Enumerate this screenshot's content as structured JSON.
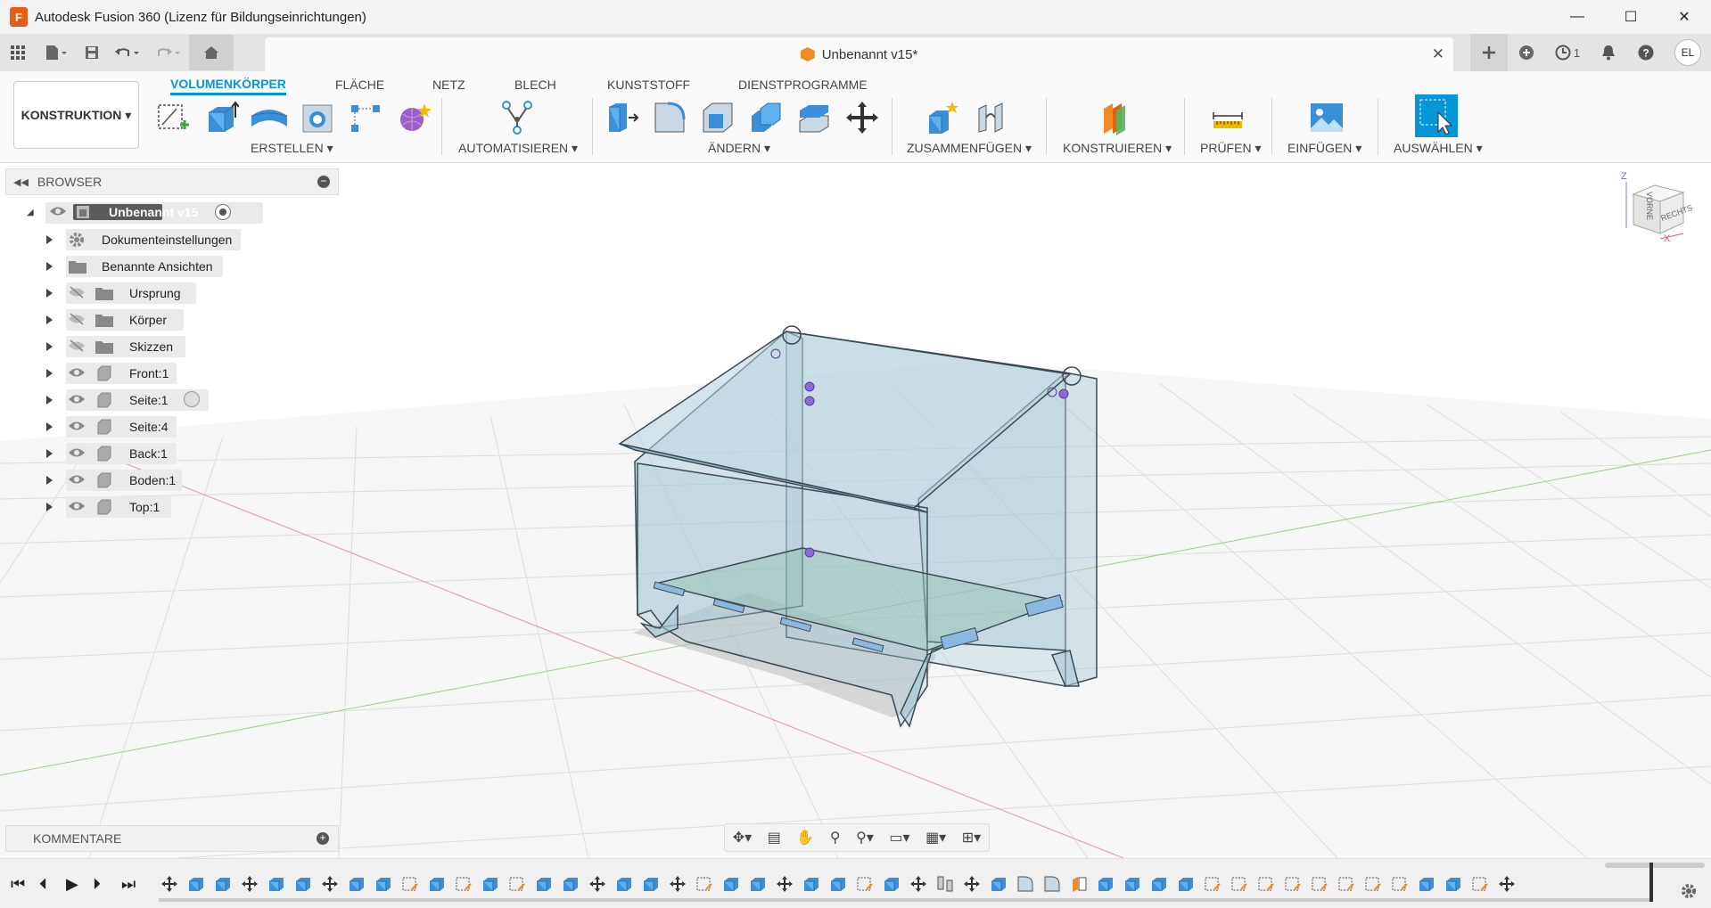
{
  "window": {
    "app_logo_letter": "F",
    "title": "Autodesk Fusion 360 (Lizenz für Bildungseinrichtungen)",
    "minimize": "—",
    "maximize": "☐",
    "close": "✕"
  },
  "docbar": {
    "doc_title": "Unbenannt v15*",
    "close_glyph": "✕",
    "job_count": "1",
    "avatar_initials": "EL"
  },
  "ribbon": {
    "workspace": "KONSTRUKTION ▾",
    "tabs": [
      "VOLUMENKÖRPER",
      "FLÄCHE",
      "NETZ",
      "BLECH",
      "KUNSTSTOFF",
      "DIENSTPROGRAMME"
    ],
    "groups": {
      "erstellen": "ERSTELLEN ▾",
      "automatisieren": "AUTOMATISIEREN ▾",
      "aendern": "ÄNDERN ▾",
      "zusammenfuegen": "ZUSAMMENFÜGEN ▾",
      "konstruieren": "KONSTRUIEREN ▾",
      "pruefen": "PRÜFEN ▾",
      "einfuegen": "EINFÜGEN ▾",
      "auswaehlen": "AUSWÄHLEN ▾"
    }
  },
  "browser": {
    "title": "BROWSER",
    "root": "Unbenannt v15",
    "items": [
      {
        "label": "Dokumenteinstellungen"
      },
      {
        "label": "Benannte Ansichten"
      },
      {
        "label": "Ursprung"
      },
      {
        "label": "Körper"
      },
      {
        "label": "Skizzen"
      },
      {
        "label": "Front:1"
      },
      {
        "label": "Seite:1"
      },
      {
        "label": "Seite:4"
      },
      {
        "label": "Back:1"
      },
      {
        "label": "Boden:1"
      },
      {
        "label": "Top:1"
      }
    ]
  },
  "viewcube": {
    "front": "VORNE",
    "right": "RECHTS",
    "z": "Z",
    "x": "X"
  },
  "comments": {
    "title": "KOMMENTARE"
  },
  "colors": {
    "accent": "#0696d7",
    "orange": "#e85d14",
    "grid": "#dcdcdc",
    "glass": "#a8c8d4"
  }
}
